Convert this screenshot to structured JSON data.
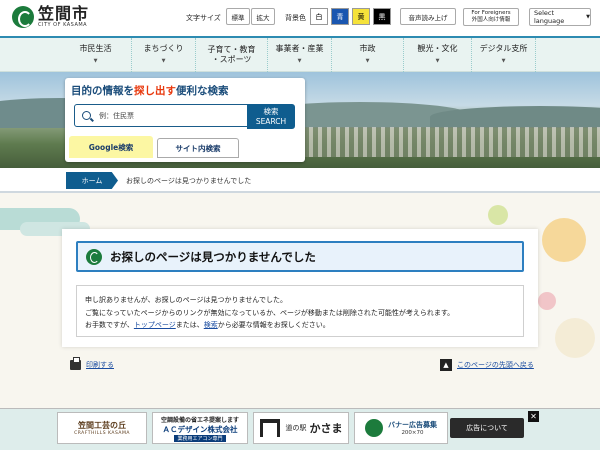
{
  "header": {
    "logo_jp": "笠間市",
    "logo_en": "CITY OF KASAMA",
    "text_size_label": "文字サイズ",
    "text_size_standard": "標準",
    "text_size_large": "拡大",
    "bg_color_label": "背景色",
    "bg_white": "白",
    "bg_blue": "青",
    "bg_yellow": "黄",
    "bg_black": "黒",
    "voice_read": "音声読み上げ",
    "foreigners_en": "For Foreigners",
    "foreigners_jp": "外国人向け情報",
    "language_select": "Select language"
  },
  "nav": {
    "items": [
      {
        "label": "市民生活"
      },
      {
        "label": "まちづくり"
      },
      {
        "label": "子育て・教育\n・スポーツ"
      },
      {
        "label": "事業者・産業"
      },
      {
        "label": "市政"
      },
      {
        "label": "観光・文化"
      },
      {
        "label": "デジタル支所"
      }
    ]
  },
  "search": {
    "title_pre": "目的の情報を",
    "title_hl": "探し出す",
    "title_post": "便利な検索",
    "placeholder": "例：住民票",
    "button_jp": "検索",
    "button_en": "SEARCH",
    "tab_google": "Google検索",
    "tab_site": "サイト内検索"
  },
  "breadcrumb": {
    "home": "ホーム",
    "current": "お探しのページは見つかりませんでした"
  },
  "main": {
    "heading": "お探しのページは見つかりませんでした",
    "line1": "申し訳ありませんが、お探しのページは見つかりませんでした。",
    "line2": "ご覧になっていたページからのリンクが無効になっているか、ページが移動または削除された可能性が考えられます。",
    "line3_pre": "お手数ですが、",
    "line3_link1": "トップページ",
    "line3_mid": "または、",
    "line3_link2": "検索",
    "line3_post": "から必要な情報をお探しください。",
    "print": "印刷する",
    "to_top": "このページの先頭へ戻る"
  },
  "banners": {
    "b1_title": "笠間工芸の丘",
    "b1_sub": "CRAFTHILLS KASAMA",
    "b2_line1": "空調設備の省エネ提案します",
    "b2_line2": "ＡＣデザイン株式会社",
    "b2_line3": "業務用エアコン専門",
    "b3_pre": "道の駅",
    "b3_name": "かさま",
    "b4_title": "バナー広告募集",
    "b4_size": "200×70",
    "about_ads": "広告について",
    "close": "✕"
  }
}
